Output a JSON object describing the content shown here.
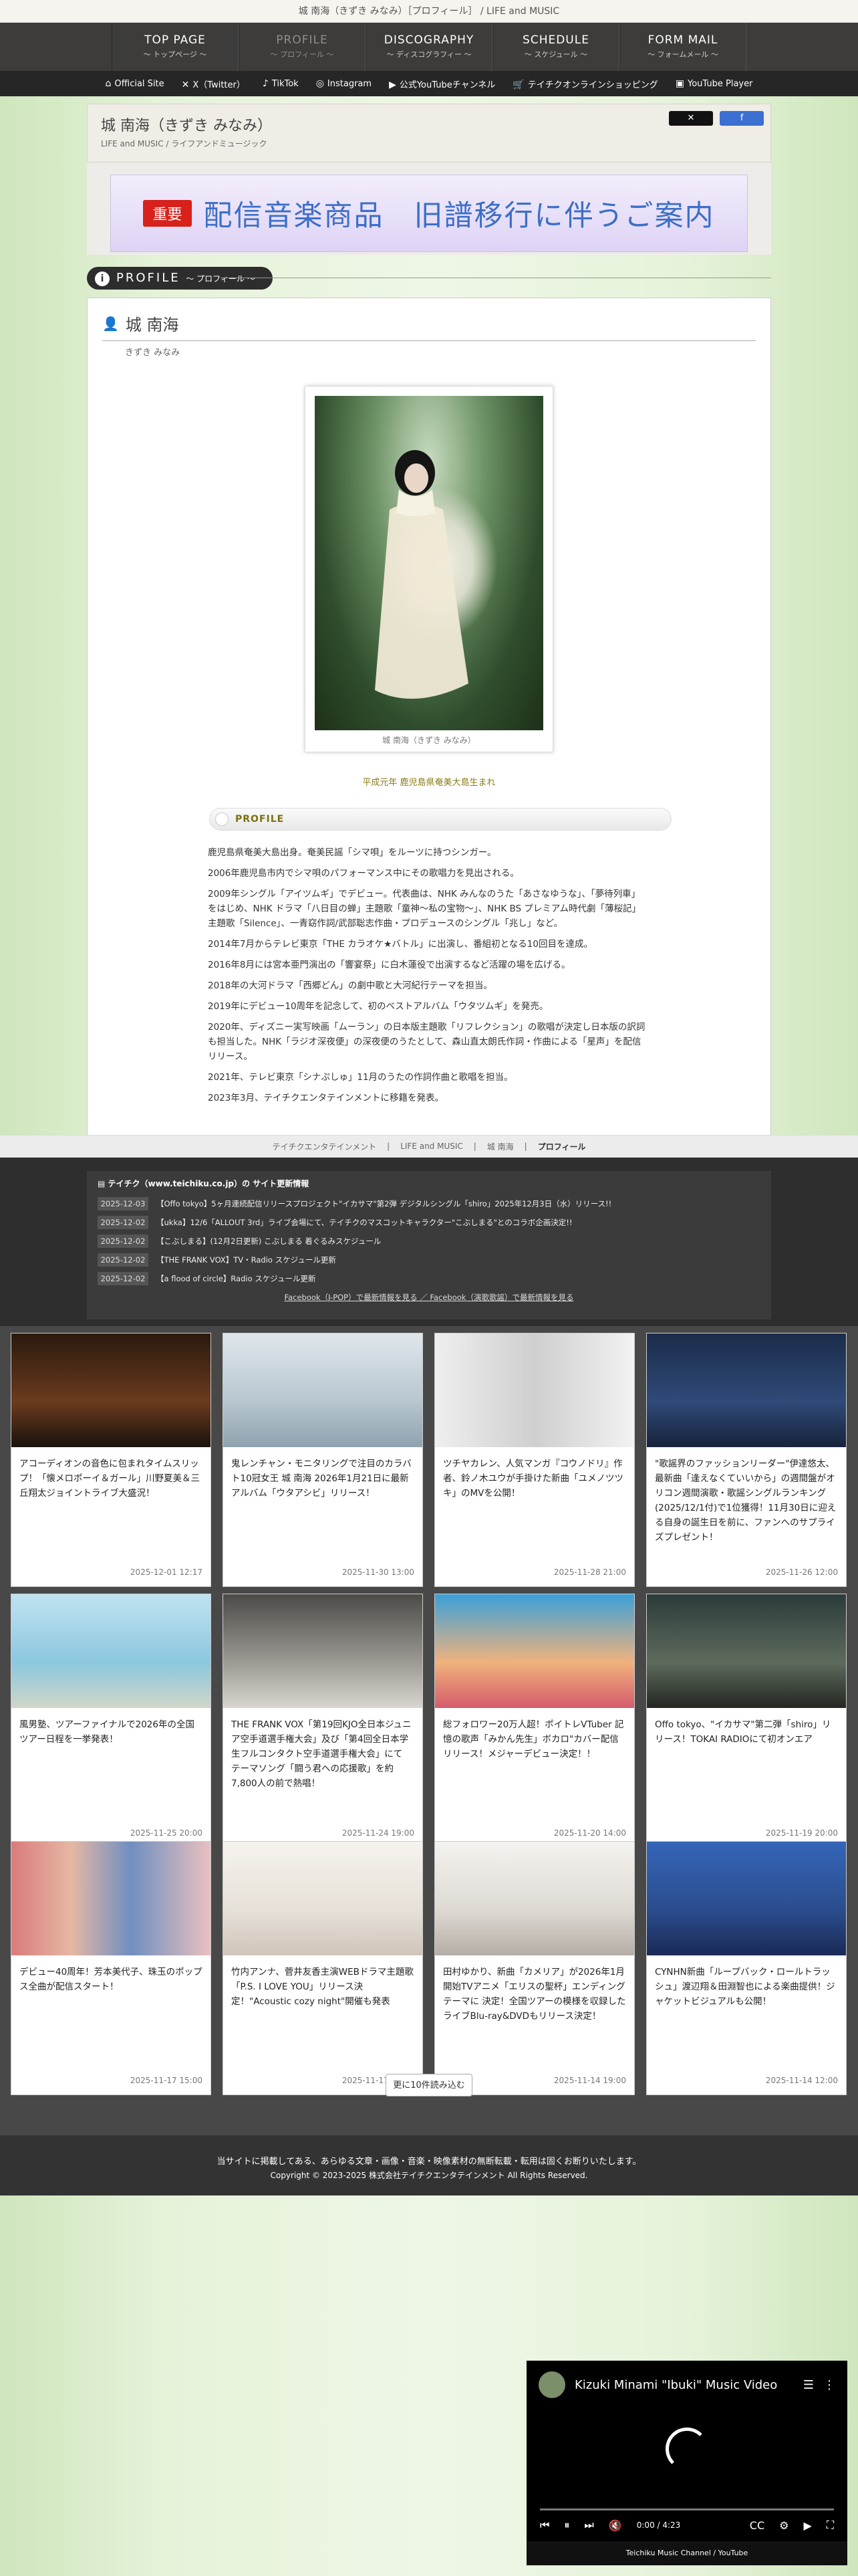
{
  "page": {
    "title": "城 南海（きずき みなみ）［プロフィール］ / LIFE and MUSIC"
  },
  "nav": [
    {
      "label": "TOP PAGE",
      "sub": "～ トップページ ～"
    },
    {
      "label": "PROFILE",
      "sub": "～ プロフィール ～"
    },
    {
      "label": "DISCOGRAPHY",
      "sub": "～ ディスコグラフィー ～"
    },
    {
      "label": "SCHEDULE",
      "sub": "～ スケジュール ～"
    },
    {
      "label": "FORM MAIL",
      "sub": "～ フォームメール ～"
    }
  ],
  "sns": [
    {
      "icon": "home-icon",
      "glyph": "⌂",
      "label": "Official Site"
    },
    {
      "icon": "x-icon",
      "glyph": "✕",
      "label": "X（Twitter）"
    },
    {
      "icon": "tiktok-icon",
      "glyph": "♪",
      "label": "TikTok"
    },
    {
      "icon": "instagram-icon",
      "glyph": "◎",
      "label": "Instagram"
    },
    {
      "icon": "youtube-icon",
      "glyph": "▶",
      "label": "公式YouTubeチャンネル"
    },
    {
      "icon": "cart-icon",
      "glyph": "🛒",
      "label": "テイチクオンラインショッピング"
    },
    {
      "icon": "player-icon",
      "glyph": "▣",
      "label": "YouTube  Player"
    }
  ],
  "header": {
    "name": "城 南海（きずき みなみ）",
    "sub": "LIFE and MUSIC / ライフアンドミュージック",
    "share_x": "✕",
    "share_fb": "f"
  },
  "banner": {
    "badge": "重要",
    "text": "配信音楽商品　旧譜移行に伴うご案内"
  },
  "section": {
    "title": "PROFILE",
    "sub": "～ プロフィール ～",
    "icon": "i"
  },
  "profile": {
    "name": "城 南海",
    "kana": "きずき みなみ",
    "photo_caption": "城 南海（きずき みなみ）",
    "birth": "平成元年 鹿児島県奄美大島生まれ",
    "subhead": "PROFILE",
    "bio": [
      "鹿児島県奄美大島出身。奄美民謡「シマ唄」をルーツに持つシンガー。",
      "2006年鹿児島市内でシマ唄のパフォーマンス中にその歌唱力を見出される。",
      "2009年シングル「アイツムギ」でデビュー。代表曲は、NHK みんなのうた「あさなゆうな」、「夢待列車」をはじめ、NHK ドラマ「八日目の蝉」主題歌「童神〜私の宝物〜」、NHK BS プレミアム時代劇「薄桜記」主題歌「Silence」、一青窈作詞/武部聡志作曲・プロデュースのシングル「兆し」など。",
      "2014年7月からテレビ東京「THE カラオケ★バトル」に出演し、番組初となる10回目を達成。",
      "2016年8月には宮本亜門演出の「響宴祭」に白木蓮役で出演するなど活躍の場を広げる。",
      "2018年の大河ドラマ「西郷どん」の劇中歌と大河紀行テーマを担当。",
      "2019年にデビュー10周年を記念して、初のベストアルバム「ウタツムギ」を発売。",
      "2020年、ディズニー実写映画「ムーラン」の日本版主題歌「リフレクション」の歌唱が決定し日本版の訳詞も担当した。NHK「ラジオ深夜便」の深夜便のうたとして、森山直太朗氏作詞・作曲による「星声」を配信リリース。",
      "2021年、テレビ東京「シナぷしゅ」11月のうたの作詞作曲と歌唱を担当。",
      "2023年3月、テイチクエンタテインメントに移籍を発表。"
    ]
  },
  "breadcrumb": [
    "テイチクエンタテインメント",
    "LIFE and MUSIC",
    "城 南海",
    "プロフィール"
  ],
  "news": {
    "header": "テイチク（www.teichiku.co.jp）の サイト更新情報",
    "rows": [
      {
        "date": "2025-12-03",
        "text": "【Offo tokyo】5ヶ月連続配信リリースプロジェクト\"イカサマ\"第2弾 デジタルシングル「shiro」2025年12月3日（水）リリース!!"
      },
      {
        "date": "2025-12-02",
        "text": "【ukka】12/6「ALLOUT 3rd」ライブ会場にて、テイチクのマスコットキャラクター\"こぶしまる\"とのコラボ企画決定!!"
      },
      {
        "date": "2025-12-02",
        "text": "【こぶしまる】(12月2日更新) こぶしまる 着ぐるみスケジュール"
      },
      {
        "date": "2025-12-02",
        "text": "【THE FRANK VOX】TV・Radio スケジュール更新"
      },
      {
        "date": "2025-12-02",
        "text": "【a flood of circle】Radio スケジュール更新"
      }
    ],
    "links": "Facebook（J-POP）で最新情報を見る ／ Facebook（演歌歌謡）で最新情報を見る"
  },
  "cards": [
    {
      "text": "アコーディオンの音色に包まれタイムスリップ！「懐メロポーイ＆ガール」川野夏美＆三丘翔太ジョイントライブ大盛況！",
      "date": "2025-12-01 12:17"
    },
    {
      "text": "鬼レンチャン・モニタリングで注目のカラバト10冠女王 城 南海 2026年1月21日に最新アルバム「ウタアシビ」リリース！",
      "date": "2025-11-30 13:00"
    },
    {
      "text": "ツチヤカレン、人気マンガ『コウノドリ』作者、鈴ノ木ユウが手掛けた新曲「ユメノツツキ」のMVを公開！",
      "date": "2025-11-28 21:00"
    },
    {
      "text": "\"歌謡界のファッションリーダー\"伊達悠太、最新曲「逢えなくていいから」の週間盤がオリコン週間演歌・歌謡シングルランキング(2025/12/1付)で1位獲得！11月30日に迎える自身の誕生日を前に、ファンへのサプライズプレゼント！",
      "date": "2025-11-26 12:00"
    },
    {
      "text": "風男塾、ツアーファイナルで2026年の全国ツアー日程を一挙発表！",
      "date": "2025-11-25 20:00"
    },
    {
      "text": "THE FRANK VOX「第19回KJO全日本ジュニア空手道選手権大会」及び「第4回全日本学生フルコンタクト空手道選手権大会」にて テーマソング「闘う君への応援歌」を約7,800人の前で熱唱！",
      "date": "2025-11-24 19:00"
    },
    {
      "text": "総フォロワー20万人超！ポイトレVTuber 記憶の歌声「みかん先生」ボカロ\"カバー配信リリース！メジャーデビュー決定！！",
      "date": "2025-11-20 14:00"
    },
    {
      "text": "Offo tokyo、\"イカサマ\"第二弾「shiro」リリース！TOKAI RADIOにて初オンエア",
      "date": "2025-11-19 20:00"
    },
    {
      "text": "デビュー40周年！芳本美代子、珠玉のポップス全曲が配信スタート！",
      "date": "2025-11-17 15:00"
    },
    {
      "text": "竹内アンナ、菅井友香主演WEBドラマ主題歌「P.S. I LOVE YOU」リリース決定！\"Acoustic cozy night\"開催も発表",
      "date": "2025-11-17 12:00"
    },
    {
      "text": "田村ゆかり、新曲「カメリア」が2026年1月開始TVアニメ「エリスの聖杯」エンディングテーマに 決定！全国ツアーの模様を収録したライブBlu-ray&DVDもリリース決定！",
      "date": "2025-11-14 19:00"
    },
    {
      "text": "CYNHN新曲「ループバック・ロールトラッシュ」渡辺翔＆田淵智也による楽曲提供！ジャケットビジュアルも公開！",
      "date": "2025-11-14 12:00"
    }
  ],
  "more_label": "更に10件読み込む",
  "footer": {
    "line1": "当サイトに掲載してある、あらゆる文章・画像・音楽・映像素材の無断転載・転用は固くお断りいたします。",
    "line2": "Copyright © 2023-2025 株式会社テイチクエンタテインメント All Rights Reserved."
  },
  "video": {
    "title": "Kizuki Minami \"Ibuki\" Music Video",
    "time": "0:00 / 4:23",
    "channel": "Teichiku Music Channel / YouTube"
  }
}
